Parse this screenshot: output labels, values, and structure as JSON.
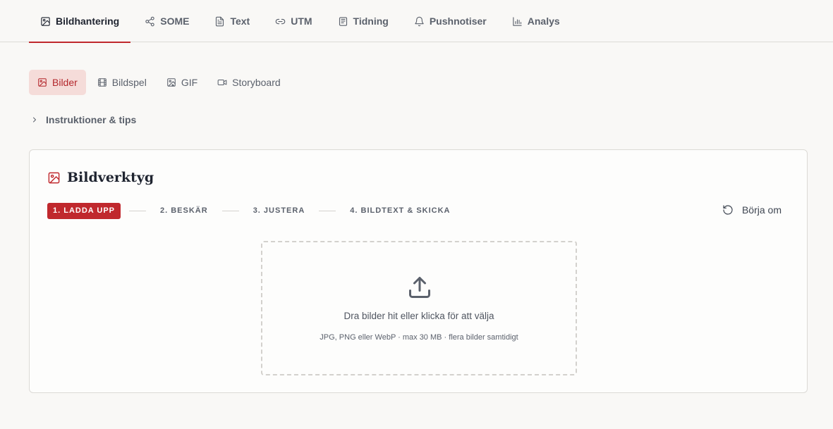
{
  "top_tabs": [
    {
      "label": "Bildhantering",
      "icon": "image-icon",
      "active": true
    },
    {
      "label": "SOME",
      "icon": "share-icon"
    },
    {
      "label": "Text",
      "icon": "document-icon"
    },
    {
      "label": "UTM",
      "icon": "link-icon"
    },
    {
      "label": "Tidning",
      "icon": "newspaper-icon"
    },
    {
      "label": "Pushnotiser",
      "icon": "bell-icon"
    },
    {
      "label": "Analys",
      "icon": "bar-chart-icon"
    }
  ],
  "sub_tabs": [
    {
      "label": "Bilder",
      "icon": "image-icon",
      "active": true
    },
    {
      "label": "Bildspel",
      "icon": "film-icon"
    },
    {
      "label": "GIF",
      "icon": "gif-image-icon"
    },
    {
      "label": "Storyboard",
      "icon": "video-icon"
    }
  ],
  "instructions": {
    "label": "Instruktioner & tips",
    "icon": "chevron-right-icon"
  },
  "card": {
    "title": "Bildverktyg",
    "icon": "image-icon",
    "steps": [
      "1. LADDA UPP",
      "2. BESKÄR",
      "3. JUSTERA",
      "4. BILDTEXT & SKICKA"
    ],
    "active_step": 0,
    "restart_label": "Börja om",
    "restart_icon": "rotate-ccw-icon",
    "dropzone": {
      "icon": "upload-icon",
      "main_text": "Dra bilder hit eller klicka för att välja",
      "sub_text": "JPG, PNG eller WebP · max 30 MB · flera bilder samtidigt"
    }
  },
  "colors": {
    "accent": "#c0282d",
    "active_subtab_bg": "#f5dcd9",
    "page_bg": "#f9f8f6"
  }
}
